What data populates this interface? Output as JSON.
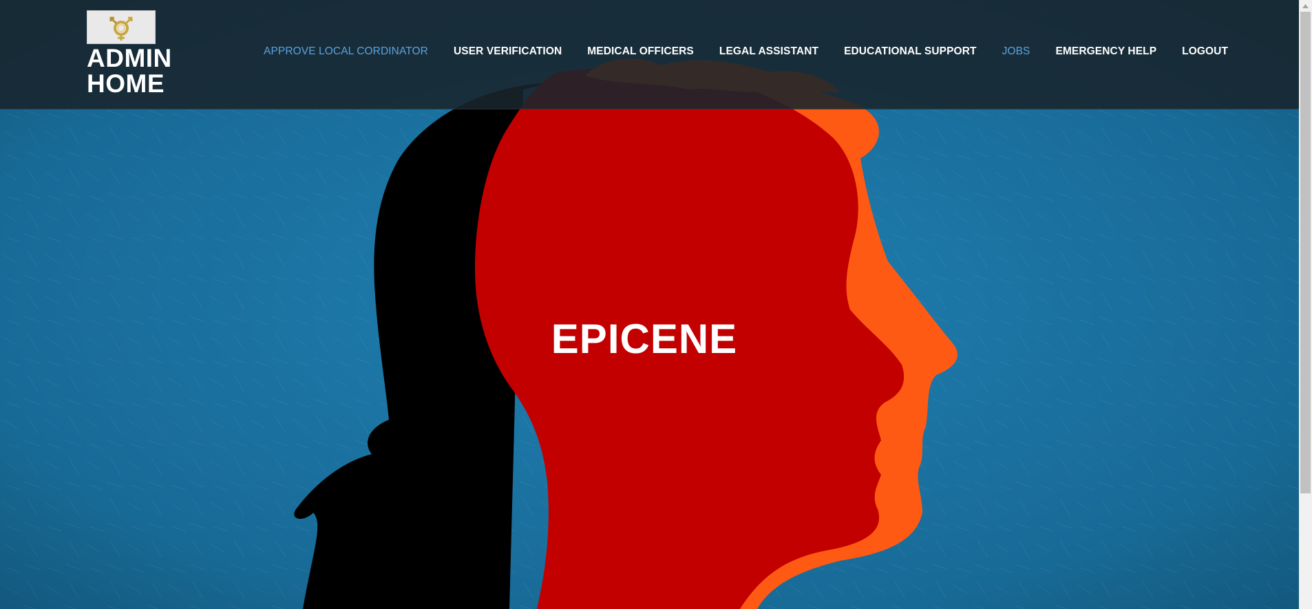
{
  "brand": {
    "title_line1": "ADMIN",
    "title_line2": "HOME"
  },
  "nav": {
    "items": [
      {
        "label": "APPROVE LOCAL CORDINATOR",
        "color": "#5aa3df"
      },
      {
        "label": "USER VERIFICATION",
        "color": "#ffffff"
      },
      {
        "label": "MEDICAL OFFICERS",
        "color": "#ffffff"
      },
      {
        "label": "LEGAL ASSISTANT",
        "color": "#ffffff"
      },
      {
        "label": "EDUCATIONAL SUPPORT",
        "color": "#ffffff"
      },
      {
        "label": "JOBS",
        "color": "#5aa3df"
      },
      {
        "label": "EMERGENCY HELP",
        "color": "#ffffff"
      },
      {
        "label": "LOGOUT",
        "color": "#ffffff"
      }
    ]
  },
  "hero": {
    "title": "EPICENE"
  },
  "colors": {
    "background_blue": "#1a6f9c",
    "head_red": "#c30000",
    "head_orange": "#ff5a14",
    "head_black": "#000000",
    "nav_bar": "#18242c"
  },
  "icons": {
    "logo": "gender-symbol-icon",
    "scroll_up": "chevron-up-icon"
  }
}
